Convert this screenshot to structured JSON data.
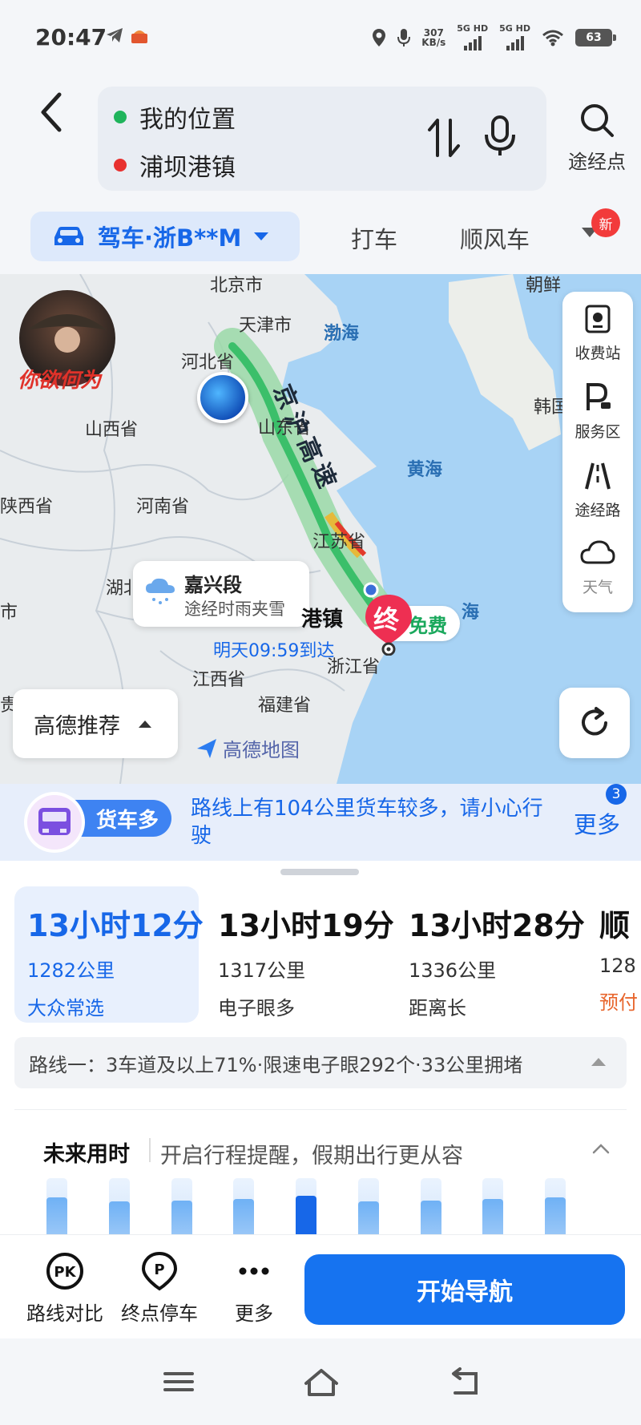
{
  "status_bar": {
    "time": "20:47",
    "net_speed_top": "307",
    "net_speed_bottom": "KB/s",
    "sim1": "5G HD",
    "sim2": "5G HD",
    "battery": "63"
  },
  "header": {
    "origin": "我的位置",
    "destination": "浦坝港镇",
    "waypoint_label": "途经点"
  },
  "mode_tabs": {
    "drive": "驾车·浙B**M",
    "taxi": "打车",
    "carpool": "顺风车",
    "new_badge": "新"
  },
  "map": {
    "avatar_text": "你欲何为",
    "labels": {
      "beijing": "北京市",
      "tianjin": "天津市",
      "hebei": "河北省",
      "shanxi": "山西省",
      "shaanxi": "陕西省",
      "henan": "河南省",
      "shandong": "山东省",
      "jiangsu": "江苏省",
      "hubei": "湖北",
      "jiangxi": "江西省",
      "zhejiang": "浙江省",
      "fujian": "福建省",
      "left_cut_1": "市",
      "left_cut_2": "贵",
      "korea": "韩国",
      "chaoxian": "朝鲜"
    },
    "seas": {
      "bohai": "渤海",
      "huanghai": "黄海",
      "donghai": "海"
    },
    "highway_name": [
      "京",
      "沪",
      "高",
      "速"
    ],
    "weather_card": {
      "title": "嘉兴段",
      "subtitle": "途经时雨夹雪"
    },
    "destination_label": "港镇",
    "end_pin": "终",
    "free_tag": "免费",
    "arrival": "明天09:59到达",
    "tools": [
      {
        "label": "收费站",
        "icon": "toll-station-icon"
      },
      {
        "label": "服务区",
        "icon": "service-area-icon"
      },
      {
        "label": "途经路",
        "icon": "road-icon"
      },
      {
        "label": "天气",
        "icon": "cloud-icon"
      }
    ],
    "recommend": "高德推荐",
    "brand": "高德地图"
  },
  "truck_banner": {
    "badge": "货车多",
    "text": "路线上有104公里货车较多，请小心行驶",
    "more": "更多",
    "more_count": "3"
  },
  "routes": [
    {
      "time": "13小时12分",
      "distance": "1282公里",
      "tag": "大众常选",
      "selected": true
    },
    {
      "time": "13小时19分",
      "distance": "1317公里",
      "tag": "电子眼多"
    },
    {
      "time": "13小时28分",
      "distance": "1336公里",
      "tag": "距离长"
    },
    {
      "time": "顺",
      "distance": "128",
      "tag": "预付"
    }
  ],
  "route_summary": "路线一：3车道及以上71%·限速电子眼292个·33公里拥堵",
  "future": {
    "title": "未来用时",
    "subtitle": "开启行程提醒，假期出行更从容",
    "bar_levels": [
      0.72,
      0.66,
      0.68,
      0.7,
      0.74,
      0.66,
      0.68,
      0.7,
      0.72
    ],
    "selected_index": 4
  },
  "actions": {
    "compare": "路线对比",
    "parking": "终点停车",
    "more": "更多",
    "start": "开始导航"
  }
}
